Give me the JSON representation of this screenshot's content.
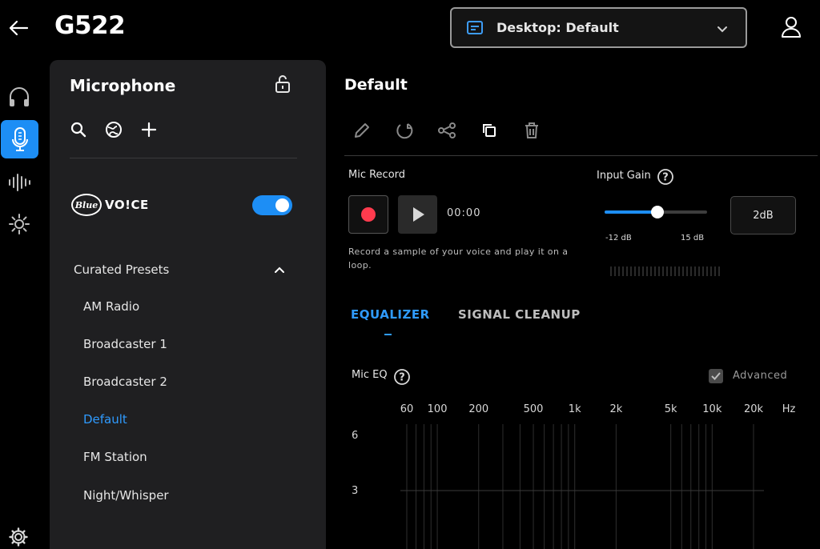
{
  "header": {
    "title": "G522",
    "profile_select": "Desktop: Default"
  },
  "rail": {
    "icons": [
      "headphones-icon",
      "microphone-icon",
      "equalizer-icon",
      "lighting-icon",
      "settings-icon"
    ]
  },
  "panel": {
    "title": "Microphone",
    "brand_logo": "Blue",
    "brand_text": "VO!CE",
    "blue_voice_enabled": true,
    "section_label": "Curated Presets",
    "presets": [
      "AM Radio",
      "Broadcaster 1",
      "Broadcaster 2",
      "Default",
      "FM Station",
      "Night/Whisper"
    ],
    "active_preset": "Default"
  },
  "main": {
    "title": "Default",
    "mic_record": {
      "label": "Mic Record",
      "timer": "00:00",
      "hint": "Record a sample of your voice and play it on a loop."
    },
    "input_gain": {
      "label": "Input Gain",
      "min_label": "-12 dB",
      "max_label": "15 dB",
      "min": -12,
      "max": 15,
      "value": 2,
      "value_label": "2dB"
    },
    "tabs": [
      {
        "label": "EQUALIZER",
        "active": true
      },
      {
        "label": "SIGNAL CLEANUP",
        "active": false
      }
    ],
    "mic_eq": {
      "label": "Mic EQ",
      "advanced_label": "Advanced",
      "advanced_checked": true
    }
  },
  "eq_axis": {
    "freq_ticks": [
      {
        "hz": 60,
        "label": "60"
      },
      {
        "hz": 100,
        "label": "100"
      },
      {
        "hz": 200,
        "label": "200"
      },
      {
        "hz": 500,
        "label": "500"
      },
      {
        "hz": 1000,
        "label": "1k"
      },
      {
        "hz": 2000,
        "label": "2k"
      },
      {
        "hz": 5000,
        "label": "5k"
      },
      {
        "hz": 10000,
        "label": "10k"
      },
      {
        "hz": 20000,
        "label": "20k"
      }
    ],
    "unit": "Hz",
    "y_ticks": [
      6,
      3
    ]
  },
  "colors": {
    "accent": "#1d8ef5",
    "record": "#ff3b4e",
    "panel": "#1f1f21"
  }
}
